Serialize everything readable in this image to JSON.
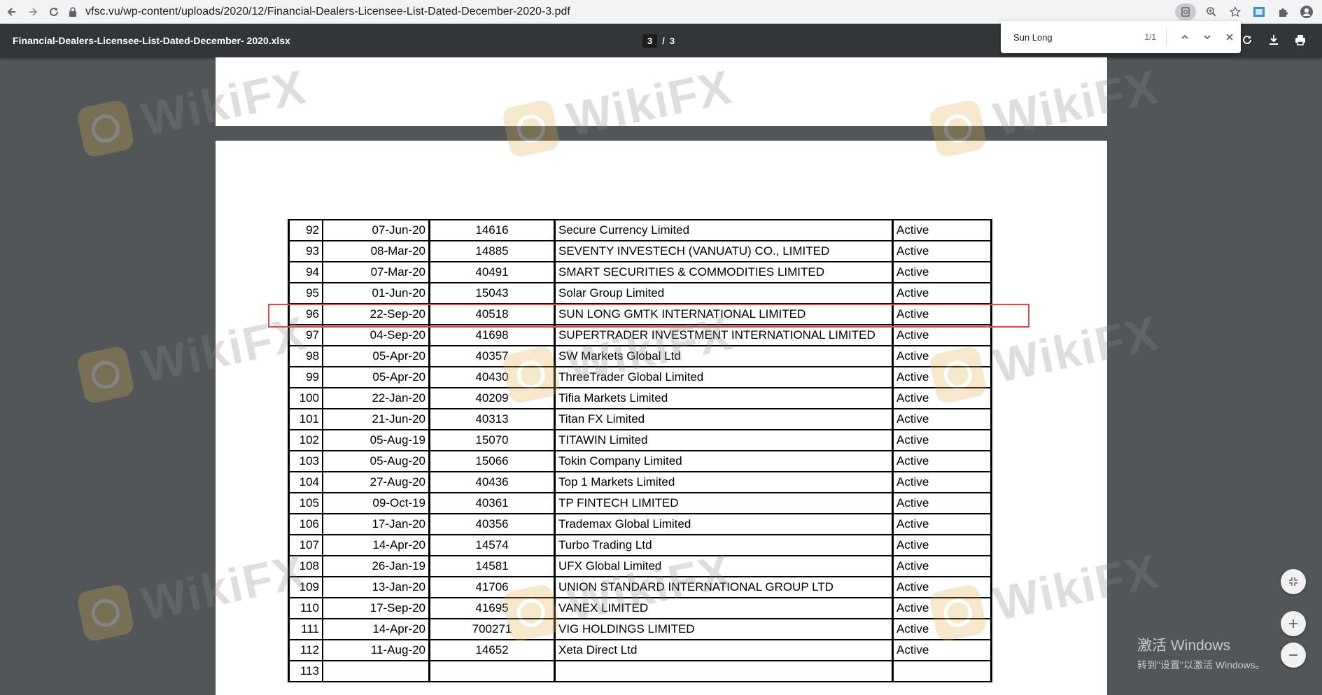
{
  "browser": {
    "url": "vfsc.vu/wp-content/uploads/2020/12/Financial-Dealers-Licensee-List-Dated-December-2020-3.pdf",
    "icons": [
      "back-icon",
      "forward-icon",
      "reload-icon",
      "lock-icon",
      "search-page-icon",
      "zoom-icon",
      "star-icon",
      "extension-icon",
      "puzzle-icon",
      "profile-icon"
    ]
  },
  "pdf": {
    "title": "Financial-Dealers-Licensee-List-Dated-December- 2020.xlsx",
    "current_page": "3",
    "separator": "/",
    "total_pages": "3"
  },
  "find": {
    "query": "Sun Long",
    "count": "1/1"
  },
  "table": {
    "rows": [
      {
        "no": "92",
        "date": "07-Jun-20",
        "license": "14616",
        "name": "Secure Currency Limited",
        "status": "Active"
      },
      {
        "no": "93",
        "date": "08-Mar-20",
        "license": "14885",
        "name": "SEVENTY INVESTECH (VANUATU) CO., LIMITED",
        "status": "Active"
      },
      {
        "no": "94",
        "date": "07-Mar-20",
        "license": "40491",
        "name": "SMART SECURITIES & COMMODITIES LIMITED",
        "status": "Active"
      },
      {
        "no": "95",
        "date": "01-Jun-20",
        "license": "15043",
        "name": "Solar Group Limited",
        "status": "Active"
      },
      {
        "no": "96",
        "date": "22-Sep-20",
        "license": "40518",
        "name": "SUN LONG GMTK INTERNATIONAL LIMITED",
        "status": "Active"
      },
      {
        "no": "97",
        "date": "04-Sep-20",
        "license": "41698",
        "name": "SUPERTRADER INVESTMENT INTERNATIONAL LIMITED",
        "status": "Active"
      },
      {
        "no": "98",
        "date": "05-Apr-20",
        "license": "40357",
        "name": "SW Markets Global Ltd",
        "status": "Active"
      },
      {
        "no": "99",
        "date": "05-Apr-20",
        "license": "40430",
        "name": "ThreeTrader Global Limited",
        "status": "Active"
      },
      {
        "no": "100",
        "date": "22-Jan-20",
        "license": "40209",
        "name": "Tifia Markets Limited",
        "status": "Active"
      },
      {
        "no": "101",
        "date": "21-Jun-20",
        "license": "40313",
        "name": "Titan FX Limited",
        "status": "Active"
      },
      {
        "no": "102",
        "date": "05-Aug-19",
        "license": "15070",
        "name": "TITAWIN Limited",
        "status": "Active"
      },
      {
        "no": "103",
        "date": "05-Aug-20",
        "license": "15066",
        "name": "Tokin Company Limited",
        "status": "Active"
      },
      {
        "no": "104",
        "date": "27-Aug-20",
        "license": "40436",
        "name": "Top 1 Markets Limited",
        "status": "Active"
      },
      {
        "no": "105",
        "date": "09-Oct-19",
        "license": "40361",
        "name": "TP FINTECH LIMITED",
        "status": "Active"
      },
      {
        "no": "106",
        "date": "17-Jan-20",
        "license": "40356",
        "name": "Trademax Global Limited",
        "status": "Active"
      },
      {
        "no": "107",
        "date": "14-Apr-20",
        "license": "14574",
        "name": "Turbo Trading Ltd",
        "status": "Active"
      },
      {
        "no": "108",
        "date": "26-Jan-19",
        "license": "14581",
        "name": "UFX Global Limited",
        "status": "Active"
      },
      {
        "no": "109",
        "date": "13-Jan-20",
        "license": "41706",
        "name": "UNION STANDARD INTERNATIONAL GROUP LTD",
        "status": "Active"
      },
      {
        "no": "110",
        "date": "17-Sep-20",
        "license": "41695",
        "name": "VANEX LIMITED",
        "status": "Active"
      },
      {
        "no": "111",
        "date": "14-Apr-20",
        "license": "700271",
        "name": "VIG HOLDINGS LIMITED",
        "status": "Active"
      },
      {
        "no": "112",
        "date": "11-Aug-20",
        "license": "14652",
        "name": "Xeta Direct Ltd",
        "status": "Active"
      },
      {
        "no": "113",
        "date": "",
        "license": "",
        "name": "",
        "status": ""
      }
    ]
  },
  "watermark": {
    "text": "WikiFX",
    "color": "#e0b04a"
  },
  "highlight": {
    "color": "#e0474c"
  },
  "activation": {
    "line1": "激活 Windows",
    "line2": "转到\"设置\"以激活 Windows。"
  }
}
